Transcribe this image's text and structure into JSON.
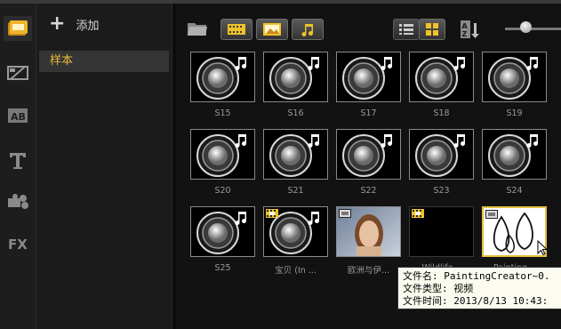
{
  "library": {
    "add_label": "添加",
    "items": [
      "样本"
    ]
  },
  "rail": {
    "icons": [
      "media-library-icon",
      "transition-icon",
      "title-icon",
      "text-icon",
      "graphics-icon",
      "filter-fx-icon"
    ]
  },
  "toolbar": {
    "view_modes": [
      "list-view",
      "thumbnail-view"
    ],
    "active_view": "thumbnail-view",
    "media_filters": [
      "video",
      "photo",
      "audio"
    ]
  },
  "media": [
    {
      "label": "S15",
      "kind": "audio"
    },
    {
      "label": "S16",
      "kind": "audio"
    },
    {
      "label": "S17",
      "kind": "audio"
    },
    {
      "label": "S18",
      "kind": "audio"
    },
    {
      "label": "S19",
      "kind": "audio"
    },
    {
      "label": "S20",
      "kind": "audio"
    },
    {
      "label": "S21",
      "kind": "audio"
    },
    {
      "label": "S22",
      "kind": "audio"
    },
    {
      "label": "S23",
      "kind": "audio"
    },
    {
      "label": "S24",
      "kind": "audio"
    },
    {
      "label": "S25",
      "kind": "audio"
    },
    {
      "label": "宝贝 (In ...",
      "kind": "audio-video"
    },
    {
      "label": "欧洲与伊...",
      "kind": "photo"
    },
    {
      "label": "Wildlife...",
      "kind": "video"
    },
    {
      "label": "Painting...",
      "kind": "painting",
      "selected": true
    }
  ],
  "tooltip": {
    "filename": "文件名: PaintingCreator~0.",
    "filetype": "文件类型: 视频",
    "filetime": "文件时间: 2013/8/13 10:43:"
  },
  "colors": {
    "accent": "#e8b83a",
    "selected_border": "#e3c040"
  }
}
